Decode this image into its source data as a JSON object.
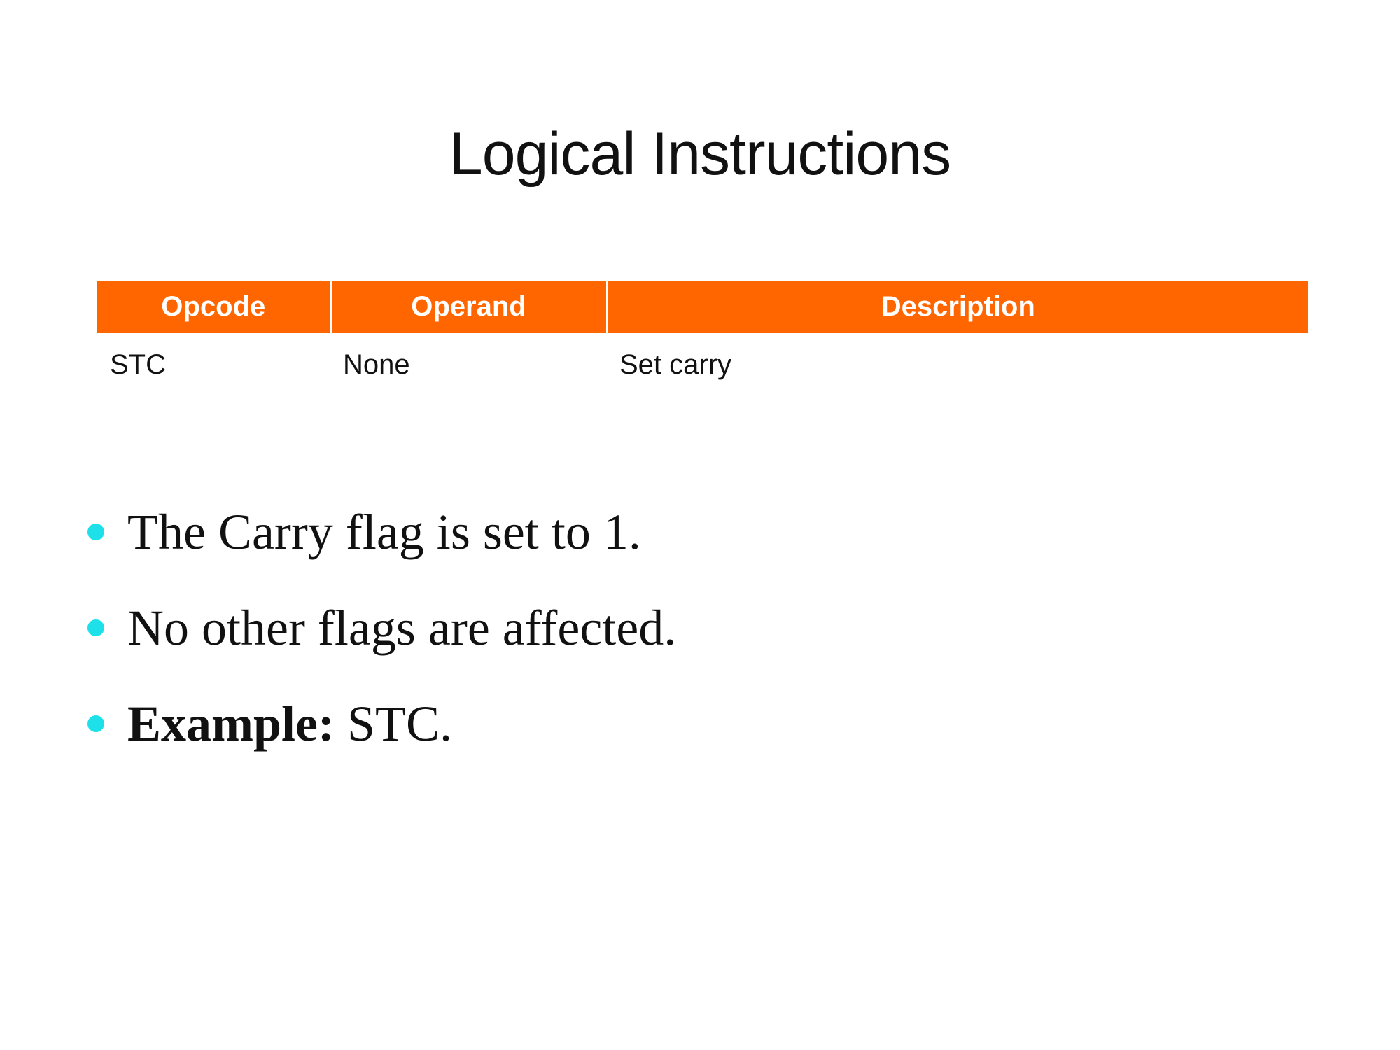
{
  "slide": {
    "title": "Logical Instructions",
    "table": {
      "headers": [
        "Opcode",
        "Operand",
        "Description"
      ],
      "rows": [
        [
          "STC",
          "None",
          "Set carry"
        ]
      ]
    },
    "bullets": [
      {
        "text": "The Carry flag is set to 1."
      },
      {
        "text": "No other flags are affected."
      },
      {
        "label": "Example:",
        "text": " STC."
      }
    ],
    "colors": {
      "header_bg": "#ff6600",
      "bullet": "#1ee0e8"
    }
  }
}
